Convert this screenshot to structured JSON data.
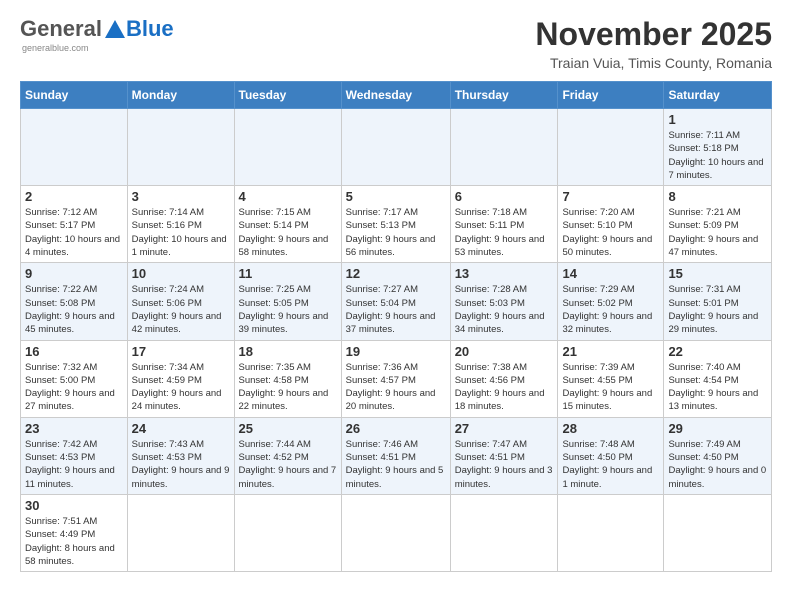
{
  "logo": {
    "general": "General",
    "blue": "Blue",
    "subtitle": "generalblue.com"
  },
  "title": "November 2025",
  "subtitle": "Traian Vuia, Timis County, Romania",
  "weekdays": [
    "Sunday",
    "Monday",
    "Tuesday",
    "Wednesday",
    "Thursday",
    "Friday",
    "Saturday"
  ],
  "weeks": [
    [
      {
        "day": "",
        "info": ""
      },
      {
        "day": "",
        "info": ""
      },
      {
        "day": "",
        "info": ""
      },
      {
        "day": "",
        "info": ""
      },
      {
        "day": "",
        "info": ""
      },
      {
        "day": "",
        "info": ""
      },
      {
        "day": "1",
        "info": "Sunrise: 7:11 AM\nSunset: 5:18 PM\nDaylight: 10 hours and 7 minutes."
      }
    ],
    [
      {
        "day": "2",
        "info": "Sunrise: 7:12 AM\nSunset: 5:17 PM\nDaylight: 10 hours and 4 minutes."
      },
      {
        "day": "3",
        "info": "Sunrise: 7:14 AM\nSunset: 5:16 PM\nDaylight: 10 hours and 1 minute."
      },
      {
        "day": "4",
        "info": "Sunrise: 7:15 AM\nSunset: 5:14 PM\nDaylight: 9 hours and 58 minutes."
      },
      {
        "day": "5",
        "info": "Sunrise: 7:17 AM\nSunset: 5:13 PM\nDaylight: 9 hours and 56 minutes."
      },
      {
        "day": "6",
        "info": "Sunrise: 7:18 AM\nSunset: 5:11 PM\nDaylight: 9 hours and 53 minutes."
      },
      {
        "day": "7",
        "info": "Sunrise: 7:20 AM\nSunset: 5:10 PM\nDaylight: 9 hours and 50 minutes."
      },
      {
        "day": "8",
        "info": "Sunrise: 7:21 AM\nSunset: 5:09 PM\nDaylight: 9 hours and 47 minutes."
      }
    ],
    [
      {
        "day": "9",
        "info": "Sunrise: 7:22 AM\nSunset: 5:08 PM\nDaylight: 9 hours and 45 minutes."
      },
      {
        "day": "10",
        "info": "Sunrise: 7:24 AM\nSunset: 5:06 PM\nDaylight: 9 hours and 42 minutes."
      },
      {
        "day": "11",
        "info": "Sunrise: 7:25 AM\nSunset: 5:05 PM\nDaylight: 9 hours and 39 minutes."
      },
      {
        "day": "12",
        "info": "Sunrise: 7:27 AM\nSunset: 5:04 PM\nDaylight: 9 hours and 37 minutes."
      },
      {
        "day": "13",
        "info": "Sunrise: 7:28 AM\nSunset: 5:03 PM\nDaylight: 9 hours and 34 minutes."
      },
      {
        "day": "14",
        "info": "Sunrise: 7:29 AM\nSunset: 5:02 PM\nDaylight: 9 hours and 32 minutes."
      },
      {
        "day": "15",
        "info": "Sunrise: 7:31 AM\nSunset: 5:01 PM\nDaylight: 9 hours and 29 minutes."
      }
    ],
    [
      {
        "day": "16",
        "info": "Sunrise: 7:32 AM\nSunset: 5:00 PM\nDaylight: 9 hours and 27 minutes."
      },
      {
        "day": "17",
        "info": "Sunrise: 7:34 AM\nSunset: 4:59 PM\nDaylight: 9 hours and 24 minutes."
      },
      {
        "day": "18",
        "info": "Sunrise: 7:35 AM\nSunset: 4:58 PM\nDaylight: 9 hours and 22 minutes."
      },
      {
        "day": "19",
        "info": "Sunrise: 7:36 AM\nSunset: 4:57 PM\nDaylight: 9 hours and 20 minutes."
      },
      {
        "day": "20",
        "info": "Sunrise: 7:38 AM\nSunset: 4:56 PM\nDaylight: 9 hours and 18 minutes."
      },
      {
        "day": "21",
        "info": "Sunrise: 7:39 AM\nSunset: 4:55 PM\nDaylight: 9 hours and 15 minutes."
      },
      {
        "day": "22",
        "info": "Sunrise: 7:40 AM\nSunset: 4:54 PM\nDaylight: 9 hours and 13 minutes."
      }
    ],
    [
      {
        "day": "23",
        "info": "Sunrise: 7:42 AM\nSunset: 4:53 PM\nDaylight: 9 hours and 11 minutes."
      },
      {
        "day": "24",
        "info": "Sunrise: 7:43 AM\nSunset: 4:53 PM\nDaylight: 9 hours and 9 minutes."
      },
      {
        "day": "25",
        "info": "Sunrise: 7:44 AM\nSunset: 4:52 PM\nDaylight: 9 hours and 7 minutes."
      },
      {
        "day": "26",
        "info": "Sunrise: 7:46 AM\nSunset: 4:51 PM\nDaylight: 9 hours and 5 minutes."
      },
      {
        "day": "27",
        "info": "Sunrise: 7:47 AM\nSunset: 4:51 PM\nDaylight: 9 hours and 3 minutes."
      },
      {
        "day": "28",
        "info": "Sunrise: 7:48 AM\nSunset: 4:50 PM\nDaylight: 9 hours and 1 minute."
      },
      {
        "day": "29",
        "info": "Sunrise: 7:49 AM\nSunset: 4:50 PM\nDaylight: 9 hours and 0 minutes."
      }
    ],
    [
      {
        "day": "30",
        "info": "Sunrise: 7:51 AM\nSunset: 4:49 PM\nDaylight: 8 hours and 58 minutes."
      },
      {
        "day": "",
        "info": ""
      },
      {
        "day": "",
        "info": ""
      },
      {
        "day": "",
        "info": ""
      },
      {
        "day": "",
        "info": ""
      },
      {
        "day": "",
        "info": ""
      },
      {
        "day": "",
        "info": ""
      }
    ]
  ]
}
